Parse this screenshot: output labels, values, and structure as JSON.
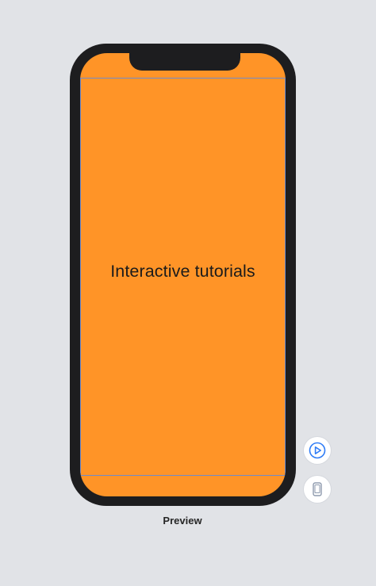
{
  "canvas": {
    "background_color": "#e1e3e7"
  },
  "preview": {
    "screen_text": "Interactive tutorials",
    "screen_color": "#ff9427",
    "caption": "Preview"
  },
  "controls": {
    "play_icon": "play-icon",
    "device_icon": "device-icon",
    "accent_color": "#2f7cf6"
  }
}
